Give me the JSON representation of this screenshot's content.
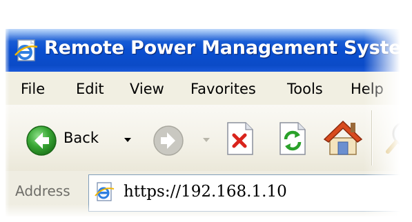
{
  "window": {
    "title": "Remote Power Management System - I",
    "icon": "ie-page-icon"
  },
  "menu": {
    "items": [
      {
        "label": "File"
      },
      {
        "label": "Edit"
      },
      {
        "label": "View"
      },
      {
        "label": "Favorites"
      },
      {
        "label": "Tools"
      },
      {
        "label": "Help"
      }
    ]
  },
  "toolbar": {
    "back_label": "Back",
    "buttons": [
      {
        "icon": "back-arrow-icon",
        "state": "enabled"
      },
      {
        "icon": "forward-arrow-icon",
        "state": "disabled"
      },
      {
        "icon": "stop-icon",
        "state": "enabled"
      },
      {
        "icon": "refresh-icon",
        "state": "enabled"
      },
      {
        "icon": "home-icon",
        "state": "enabled"
      },
      {
        "icon": "search-icon",
        "state": "enabled"
      }
    ]
  },
  "address": {
    "label": "Address",
    "value": "https://192.168.1.10"
  },
  "colors": {
    "title_bar": "#0a4fd0",
    "back_button": "#2f9e2f",
    "stop_icon": "#d9241c",
    "refresh_icon": "#2aa12a",
    "home_roof": "#d84b1e"
  }
}
